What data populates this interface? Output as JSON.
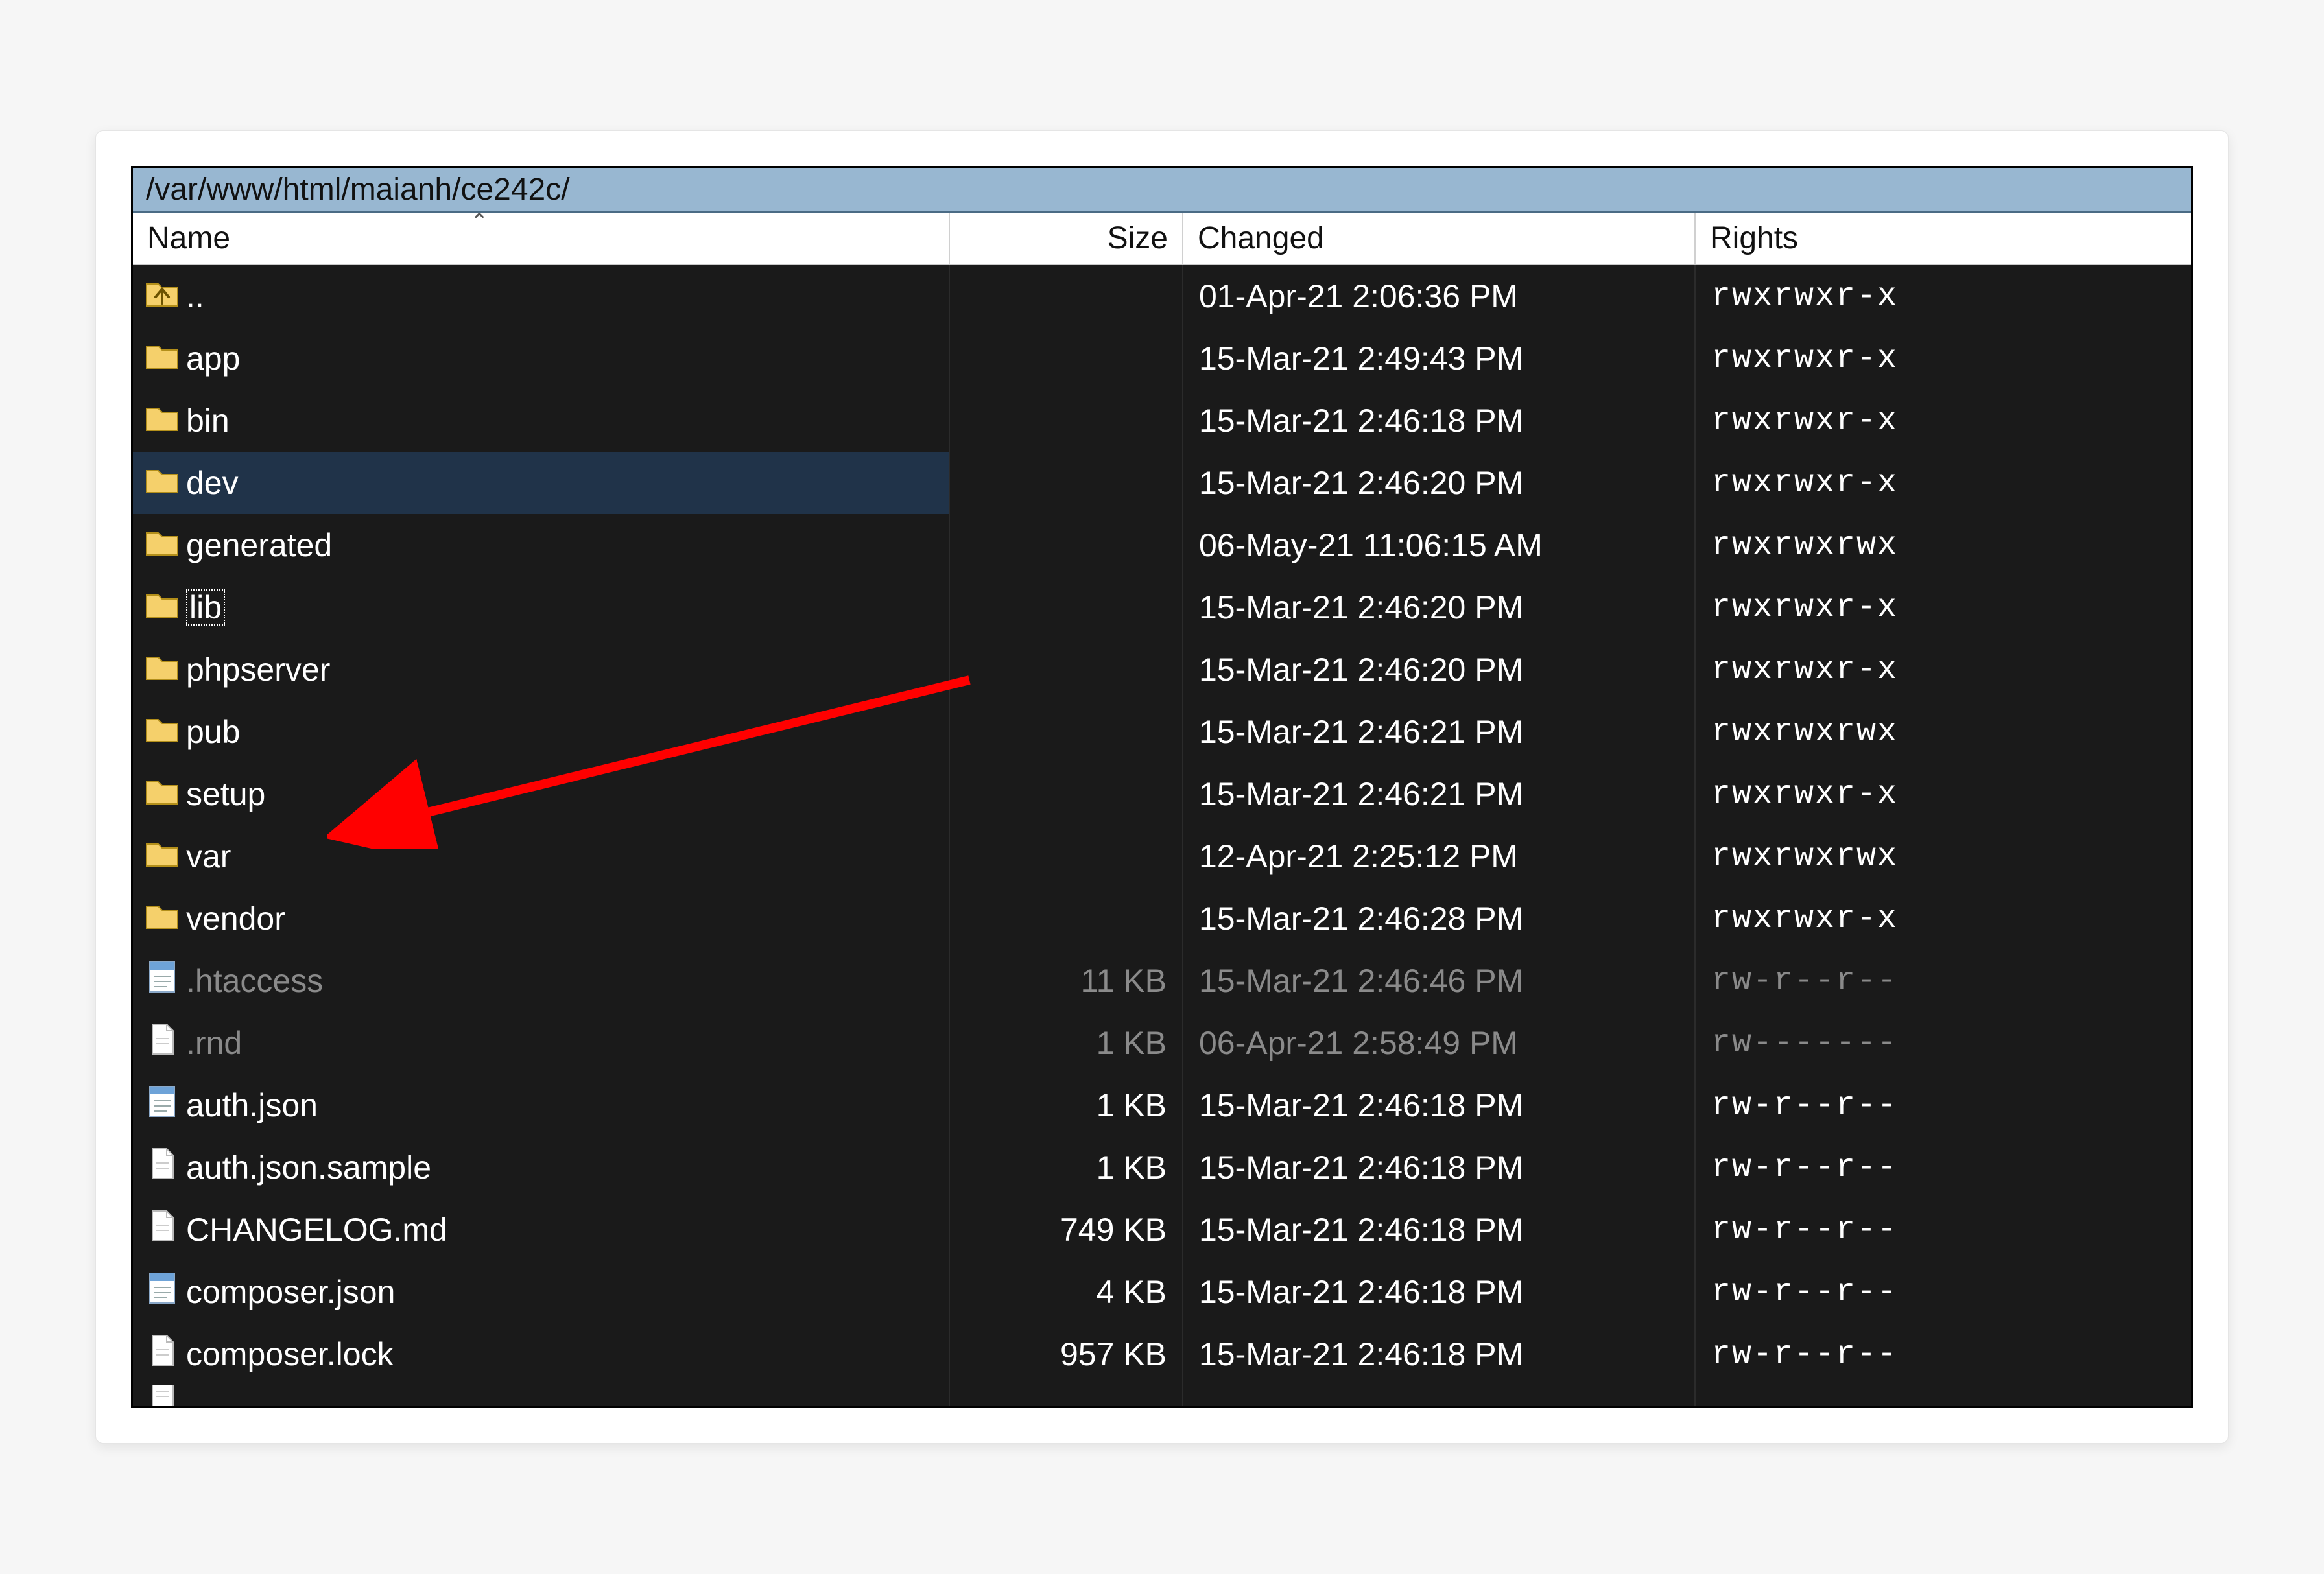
{
  "path": "/var/www/html/maianh/ce242c/",
  "columns": {
    "name": "Name",
    "size": "Size",
    "changed": "Changed",
    "rights": "Rights"
  },
  "rows": [
    {
      "icon": "parent",
      "name": "..",
      "size": "",
      "changed": "01-Apr-21 2:06:36 PM",
      "rights": "rwxrwxr-x",
      "dimmed": false,
      "selected": false,
      "focused": false
    },
    {
      "icon": "folder",
      "name": "app",
      "size": "",
      "changed": "15-Mar-21 2:49:43 PM",
      "rights": "rwxrwxr-x",
      "dimmed": false,
      "selected": false,
      "focused": false
    },
    {
      "icon": "folder",
      "name": "bin",
      "size": "",
      "changed": "15-Mar-21 2:46:18 PM",
      "rights": "rwxrwxr-x",
      "dimmed": false,
      "selected": false,
      "focused": false
    },
    {
      "icon": "folder",
      "name": "dev",
      "size": "",
      "changed": "15-Mar-21 2:46:20 PM",
      "rights": "rwxrwxr-x",
      "dimmed": false,
      "selected": true,
      "focused": false
    },
    {
      "icon": "folder",
      "name": "generated",
      "size": "",
      "changed": "06-May-21 11:06:15 AM",
      "rights": "rwxrwxrwx",
      "dimmed": false,
      "selected": false,
      "focused": false
    },
    {
      "icon": "folder",
      "name": "lib",
      "size": "",
      "changed": "15-Mar-21 2:46:20 PM",
      "rights": "rwxrwxr-x",
      "dimmed": false,
      "selected": false,
      "focused": true
    },
    {
      "icon": "folder",
      "name": "phpserver",
      "size": "",
      "changed": "15-Mar-21 2:46:20 PM",
      "rights": "rwxrwxr-x",
      "dimmed": false,
      "selected": false,
      "focused": false
    },
    {
      "icon": "folder",
      "name": "pub",
      "size": "",
      "changed": "15-Mar-21 2:46:21 PM",
      "rights": "rwxrwxrwx",
      "dimmed": false,
      "selected": false,
      "focused": false
    },
    {
      "icon": "folder",
      "name": "setup",
      "size": "",
      "changed": "15-Mar-21 2:46:21 PM",
      "rights": "rwxrwxr-x",
      "dimmed": false,
      "selected": false,
      "focused": false
    },
    {
      "icon": "folder",
      "name": "var",
      "size": "",
      "changed": "12-Apr-21 2:25:12 PM",
      "rights": "rwxrwxrwx",
      "dimmed": false,
      "selected": false,
      "focused": false
    },
    {
      "icon": "folder",
      "name": "vendor",
      "size": "",
      "changed": "15-Mar-21 2:46:28 PM",
      "rights": "rwxrwxr-x",
      "dimmed": false,
      "selected": false,
      "focused": false
    },
    {
      "icon": "notepad",
      "name": ".htaccess",
      "size": "11 KB",
      "changed": "15-Mar-21 2:46:46 PM",
      "rights": "rw-r--r--",
      "dimmed": true,
      "selected": false,
      "focused": false
    },
    {
      "icon": "file",
      "name": ".rnd",
      "size": "1 KB",
      "changed": "06-Apr-21 2:58:49 PM",
      "rights": "rw-------",
      "dimmed": true,
      "selected": false,
      "focused": false
    },
    {
      "icon": "notepad",
      "name": "auth.json",
      "size": "1 KB",
      "changed": "15-Mar-21 2:46:18 PM",
      "rights": "rw-r--r--",
      "dimmed": false,
      "selected": false,
      "focused": false
    },
    {
      "icon": "file",
      "name": "auth.json.sample",
      "size": "1 KB",
      "changed": "15-Mar-21 2:46:18 PM",
      "rights": "rw-r--r--",
      "dimmed": false,
      "selected": false,
      "focused": false
    },
    {
      "icon": "file",
      "name": "CHANGELOG.md",
      "size": "749 KB",
      "changed": "15-Mar-21 2:46:18 PM",
      "rights": "rw-r--r--",
      "dimmed": false,
      "selected": false,
      "focused": false
    },
    {
      "icon": "notepad",
      "name": "composer.json",
      "size": "4 KB",
      "changed": "15-Mar-21 2:46:18 PM",
      "rights": "rw-r--r--",
      "dimmed": false,
      "selected": false,
      "focused": false
    },
    {
      "icon": "file",
      "name": "composer.lock",
      "size": "957 KB",
      "changed": "15-Mar-21 2:46:18 PM",
      "rights": "rw-r--r--",
      "dimmed": false,
      "selected": false,
      "focused": false
    }
  ],
  "annotation": {
    "target_row": "lib"
  }
}
